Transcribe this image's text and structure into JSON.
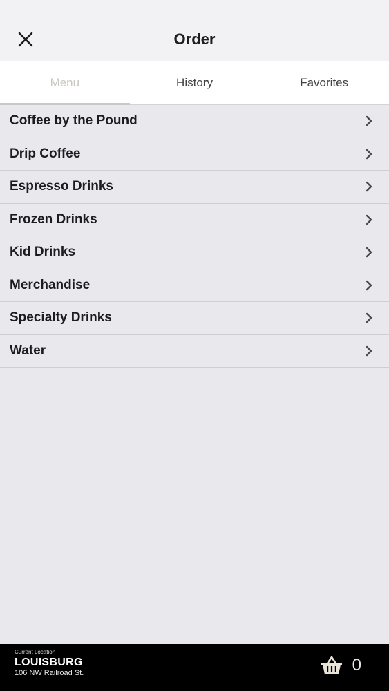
{
  "header": {
    "title": "Order",
    "close_icon": "close-icon"
  },
  "tabs": [
    {
      "label": "Menu",
      "active": true
    },
    {
      "label": "History",
      "active": false
    },
    {
      "label": "Favorites",
      "active": false
    }
  ],
  "menu": {
    "chevron_icon": "chevron-right-icon",
    "items": [
      {
        "label": "Coffee by the Pound"
      },
      {
        "label": "Drip Coffee"
      },
      {
        "label": "Espresso Drinks"
      },
      {
        "label": "Frozen Drinks"
      },
      {
        "label": "Kid Drinks"
      },
      {
        "label": "Merchandise"
      },
      {
        "label": "Specialty Drinks"
      },
      {
        "label": "Water"
      }
    ]
  },
  "footer": {
    "location_caption": "Current Location",
    "location_name": "LOUISBURG",
    "location_address": "106 NW Railroad St.",
    "cart_icon": "basket-icon",
    "cart_count": "0"
  },
  "colors": {
    "background": "#e9e8ed",
    "active_tab_text": "#c9c7be",
    "footer_bg": "#000000"
  }
}
